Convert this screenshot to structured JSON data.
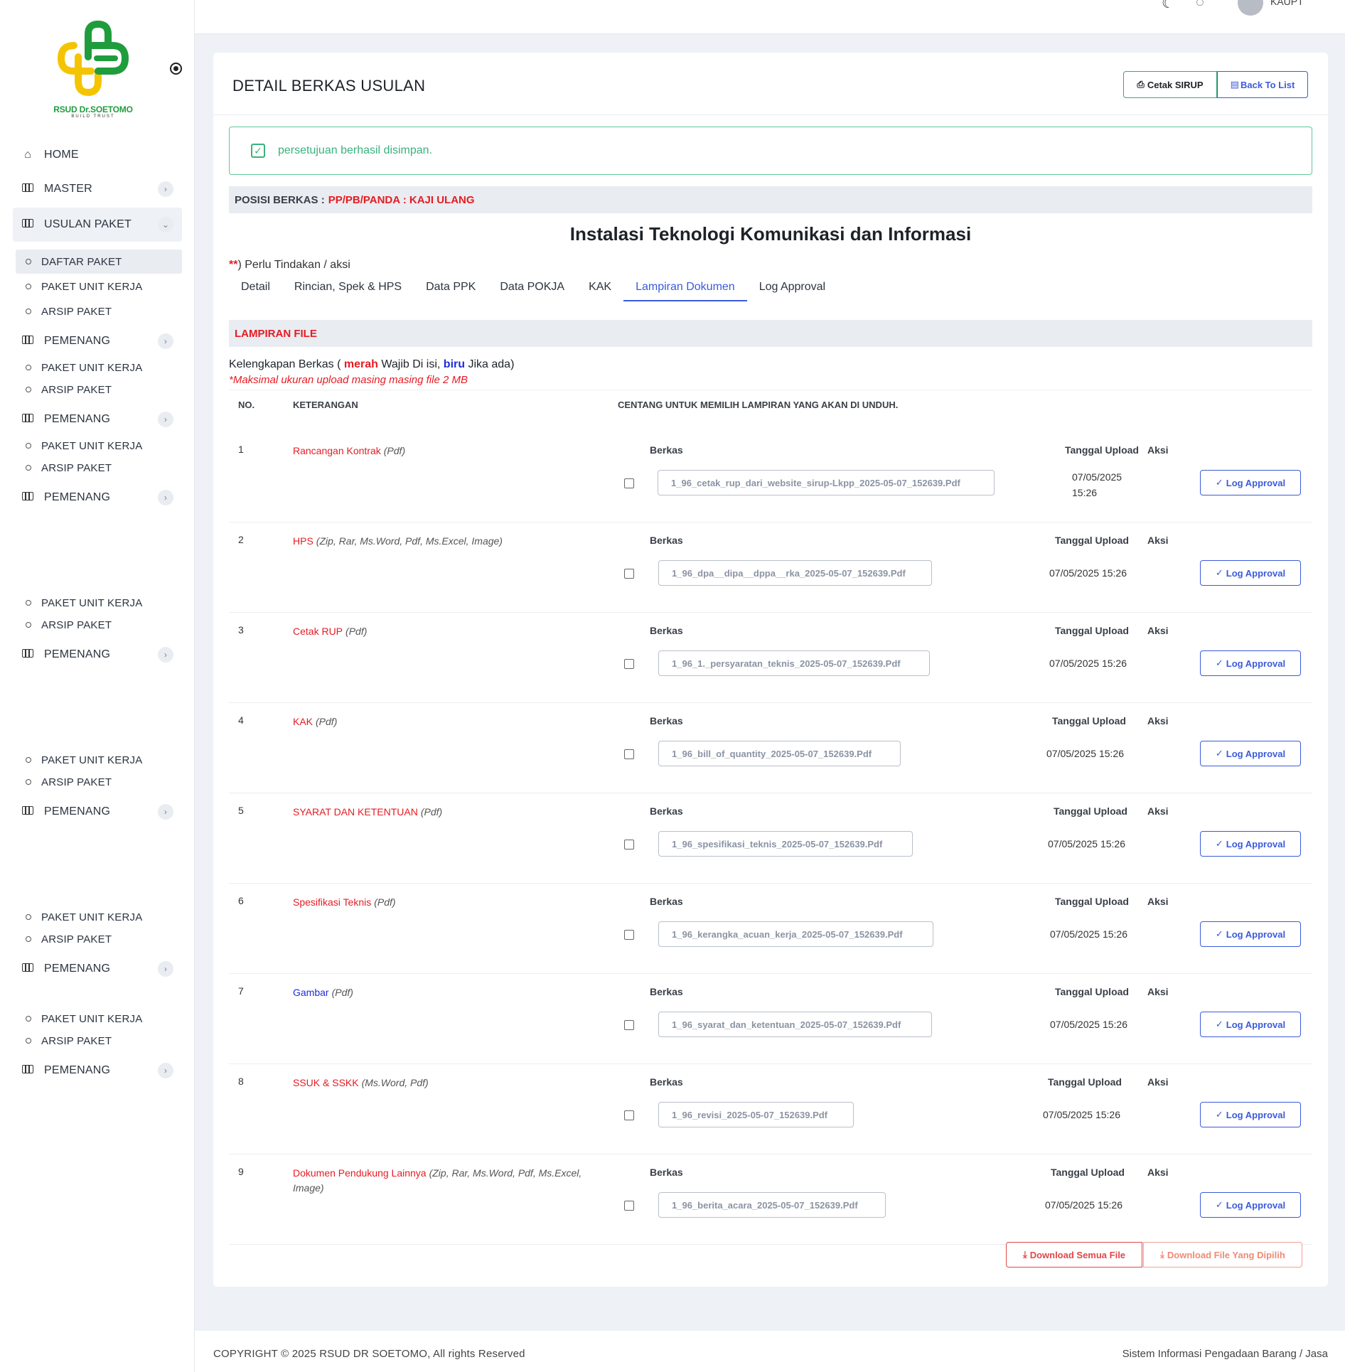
{
  "logo": {
    "text": "RSUD Dr.SOETOMO",
    "sub": "BUILD TRUST"
  },
  "topbar": {
    "user_name": "KAUPT"
  },
  "sidebar": {
    "home": "HOME",
    "master": "MASTER",
    "usulan_paket": "USULAN PAKET",
    "daftar_paket": "DAFTAR PAKET",
    "paket_unit_kerja": "PAKET UNIT KERJA",
    "arsip_paket": "ARSIP PAKET",
    "pemenang": "PEMENANG"
  },
  "header": {
    "title": "DETAIL BERKAS USULAN",
    "cetak_sirup": "Cetak SIRUP",
    "back_to_list": "Back To List"
  },
  "alert": {
    "message": "persetujuan berhasil disimpan."
  },
  "posisi": {
    "label": "POSISI BERKAS :",
    "value": "PP/PB/PANDA : KAJI ULANG"
  },
  "unit_title": "Instalasi Teknologi Komunikasi dan Informasi",
  "note": {
    "mark": "**",
    "text": ") Perlu Tindakan / aksi"
  },
  "tabs": [
    "Detail",
    "Rincian, Spek & HPS",
    "Data PPK",
    "Data POKJA",
    "KAK",
    "Lampiran Dokumen",
    "Log Approval"
  ],
  "active_tab": "Lampiran Dokumen",
  "lampiran": {
    "title": "LAMPIRAN FILE",
    "kel_prefix": "Kelengkapan Berkas (",
    "kel_merah": "merah",
    "kel_mid": "Wajib Di isi,",
    "kel_biru": "biru",
    "kel_suffix": "Jika ada)",
    "maks": "*Maksimal ukuran upload masing masing file 2 MB"
  },
  "table_headers": {
    "no": "NO.",
    "keterangan": "KETERANGAN",
    "centang": "CENTANG UNTUK MEMILIH LAMPIRAN YANG AKAN DI UNDUH."
  },
  "row_labels": {
    "berkas": "Berkas",
    "tanggal": "Tanggal Upload",
    "aksi": "Aksi",
    "log": "Log Approval"
  },
  "rows": [
    {
      "no": "1",
      "name": "Rancangan Kontrak",
      "type": "(Pdf)",
      "file": "1_96_cetak_rup_dari_website_sirup-Lkpp_2025-05-07_152639.Pdf",
      "tgl": "07/05/2025 15:26",
      "color": "red"
    },
    {
      "no": "2",
      "name": "HPS",
      "type": "(Zip, Rar, Ms.Word, Pdf, Ms.Excel, Image)",
      "file": "1_96_dpa__dipa__dppa__rka_2025-05-07_152639.Pdf",
      "tgl": "07/05/2025 15:26",
      "color": "red"
    },
    {
      "no": "3",
      "name": "Cetak RUP",
      "type": "(Pdf)",
      "file": "1_96_1._persyaratan_teknis_2025-05-07_152639.Pdf",
      "tgl": "07/05/2025 15:26",
      "color": "red"
    },
    {
      "no": "4",
      "name": "KAK",
      "type": "(Pdf)",
      "file": "1_96_bill_of_quantity_2025-05-07_152639.Pdf",
      "tgl": "07/05/2025 15:26",
      "color": "red"
    },
    {
      "no": "5",
      "name": "SYARAT DAN KETENTUAN",
      "type": "(Pdf)",
      "file": "1_96_spesifikasi_teknis_2025-05-07_152639.Pdf",
      "tgl": "07/05/2025 15:26",
      "color": "red"
    },
    {
      "no": "6",
      "name": "Spesifikasi Teknis",
      "type": "(Pdf)",
      "file": "1_96_kerangka_acuan_kerja_2025-05-07_152639.Pdf",
      "tgl": "07/05/2025 15:26",
      "color": "red"
    },
    {
      "no": "7",
      "name": "Gambar",
      "type": "(Pdf)",
      "file": "1_96_syarat_dan_ketentuan_2025-05-07_152639.Pdf",
      "tgl": "07/05/2025 15:26",
      "color": "blue"
    },
    {
      "no": "8",
      "name": "SSUK & SSKK",
      "type": "(Ms.Word, Pdf)",
      "file": "1_96_revisi_2025-05-07_152639.Pdf",
      "tgl": "07/05/2025 15:26",
      "color": "red"
    },
    {
      "no": "9",
      "name": "Dokumen Pendukung Lainnya",
      "type": "(Zip, Rar, Ms.Word, Pdf, Ms.Excel, Image)",
      "file": "1_96_berita_acara_2025-05-07_152639.Pdf",
      "tgl": "07/05/2025 15:26",
      "color": "red"
    }
  ],
  "downloads": {
    "all": "Download Semua File",
    "selected": "Download File Yang Dipilih"
  },
  "footer": {
    "copyright": "COPYRIGHT © 2025 RSUD DR SOETOMO, All rights Reserved",
    "system": "Sistem Informasi Pengadaan Barang / Jasa"
  },
  "colors": {
    "accent": "#3b5bdb",
    "success": "#3ab27d",
    "danger": "#e51c23",
    "blue_text": "#1d2ed8"
  }
}
